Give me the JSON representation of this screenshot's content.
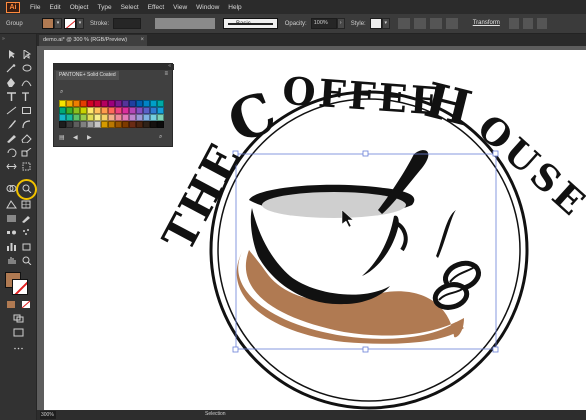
{
  "app": {
    "logo": "Ai"
  },
  "menu": [
    "File",
    "Edit",
    "Object",
    "Type",
    "Select",
    "Effect",
    "View",
    "Window",
    "Help"
  ],
  "control_bar": {
    "selection_label": "Group",
    "stroke_label": "Stroke:",
    "brush_label": "Basic",
    "opacity_label": "Opacity:",
    "opacity_value": "100%",
    "style_label": "Style:",
    "transform_label": "Transform"
  },
  "document": {
    "tab_title": "demo.ai* @ 300 % (RGB/Preview)",
    "close_glyph": "×"
  },
  "status_bar": {
    "zoom": "300%",
    "tool_text": "Selection"
  },
  "panel": {
    "title": "PANTONE+ Solid Coated",
    "collapse_glyph": "«",
    "menu_glyph": "≡",
    "search_glyph": "⌕",
    "footer_icons": [
      "library-icon",
      "previous-icon",
      "next-icon",
      "search-icon"
    ],
    "swatch_colors": [
      "#f6e400",
      "#f0a800",
      "#ee7e00",
      "#e53c00",
      "#d20026",
      "#c8003a",
      "#b5005f",
      "#9c007c",
      "#7b1a8e",
      "#54349a",
      "#1f3fa0",
      "#0060b0",
      "#0083c6",
      "#00a0c8",
      "#00a9a5",
      "#00a878",
      "#3dae2b",
      "#8bbf1e",
      "#c9d200",
      "#ffe96e",
      "#ffc25c",
      "#ff9b4d",
      "#ff6a5a",
      "#f0457f",
      "#db2f9d",
      "#b447b6",
      "#8352c2",
      "#5a62c8",
      "#2f7cd2",
      "#16a0d8",
      "#13b6c8",
      "#18b89c",
      "#5cc06a",
      "#9acb4c",
      "#e1dc53",
      "#f7ef8c",
      "#f5d268",
      "#f4b08a",
      "#ef8d9a",
      "#e47ab8",
      "#bd86cf",
      "#9d9ad8",
      "#7fb1e3",
      "#74cfe0",
      "#7cd2b6",
      "#1d1d1d",
      "#3b3b3b",
      "#5e5e5e",
      "#808080",
      "#a4a4a4",
      "#c6c6c6",
      "#d69a00",
      "#bb7700",
      "#9a5400",
      "#7d3a00",
      "#6a2b14",
      "#4e2612",
      "#2f2218",
      "#15110f",
      "#0b0b0b"
    ]
  },
  "artwork": {
    "brand_color": "#b07a52",
    "ink_color": "#111111",
    "title_top": "OFFEE",
    "title_left": "THE",
    "title_right": "OUSE",
    "title_c": "C",
    "title_h": "H"
  }
}
